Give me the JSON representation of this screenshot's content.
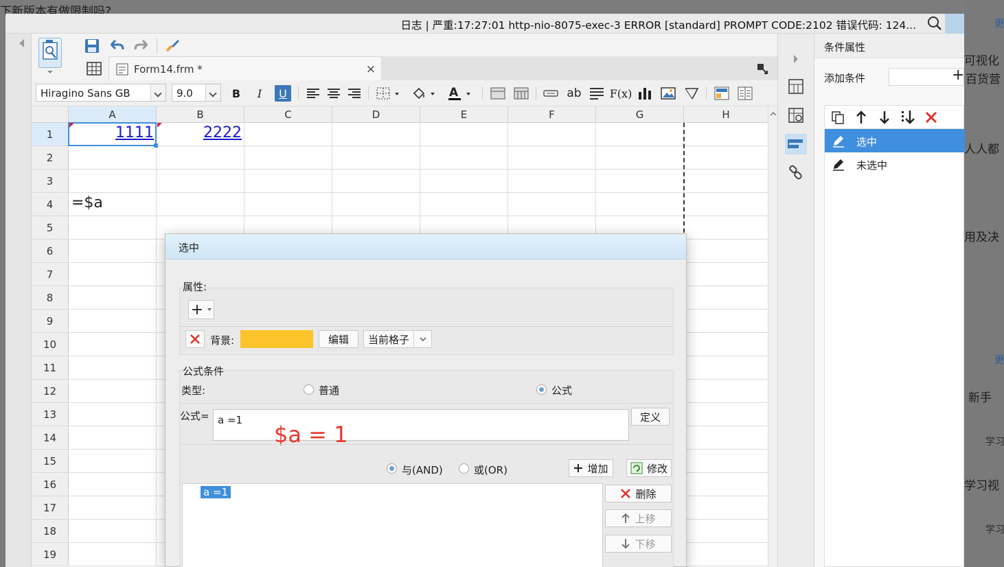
{
  "background_page": {
    "texts": [
      "下新版本有做限制吗?",
      "可视化",
      "百货营",
      "人人都",
      "用及决",
      "新手",
      "学习视"
    ],
    "small_texts": [
      "学习",
      "学习"
    ],
    "links": [
      "更",
      "更"
    ]
  },
  "titlebar": {
    "log_text": "日志 | 严重:17:27:01 http-nio-8075-exec-3 ERROR [standard] PROMPT CODE:2102 错误代码: 124..."
  },
  "tab": {
    "title": "Form14.frm *",
    "close": "×"
  },
  "format_toolbar": {
    "font_family": "Hiragino Sans GB",
    "font_size": "9.0",
    "bold": "B",
    "italic": "I",
    "underline": "U",
    "text_label_ab": "ab",
    "formula_label": "F(x)"
  },
  "grid": {
    "columns": [
      "A",
      "B",
      "C",
      "D",
      "E",
      "F",
      "G",
      "H"
    ],
    "rows": [
      "1",
      "2",
      "3",
      "4",
      "5",
      "6",
      "7",
      "8",
      "9",
      "10",
      "11",
      "12",
      "13",
      "14",
      "15",
      "16",
      "17",
      "18",
      "19"
    ],
    "cells": {
      "A1": "1111",
      "B1": "2222",
      "A4": "=$a"
    }
  },
  "property_panel": {
    "title": "条件属性",
    "add_condition_label": "添加条件",
    "add_plus": "+",
    "items": [
      {
        "label": "选中",
        "selected": true
      },
      {
        "label": "未选中",
        "selected": false
      }
    ]
  },
  "dialog": {
    "title": "选中",
    "attributes_label": "属性:",
    "add_attr": "+",
    "background_label": "背景:",
    "background_color": "#fbc42b",
    "edit_button": "编辑",
    "scope_select": "当前格子",
    "formula_section_label": "公式条件",
    "type_label": "类型:",
    "type_options": [
      {
        "label": "普通",
        "selected": false
      },
      {
        "label": "公式",
        "selected": true
      }
    ],
    "formula_label": "公式=",
    "formula_value": "a =1",
    "define_button": "定义",
    "logic_options": [
      {
        "label": "与(AND)",
        "selected": true
      },
      {
        "label": "或(OR)",
        "selected": false
      }
    ],
    "add_button": "增加",
    "modify_button": "修改",
    "delete_button": "删除",
    "move_up_button": "上移",
    "move_down_button": "下移",
    "condition_items": [
      "a =1"
    ]
  },
  "annotation": {
    "text": "$a = 1",
    "color": "#e8382c"
  },
  "colors": {
    "accent": "#3f8fde",
    "link_blue": "#1a1acc"
  }
}
